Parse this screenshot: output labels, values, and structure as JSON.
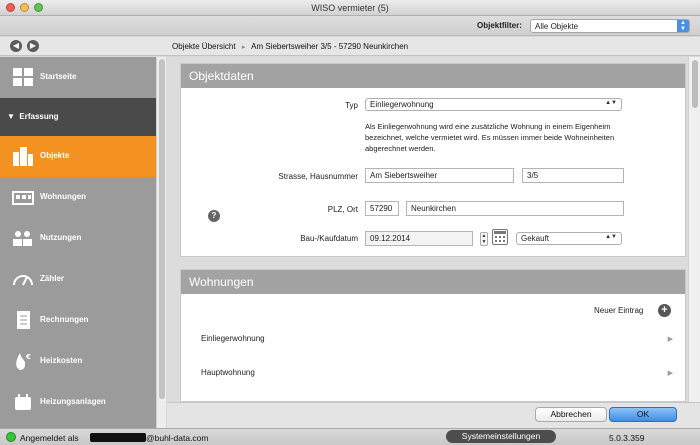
{
  "window": {
    "title": "WISO vermieter (5)"
  },
  "filter": {
    "label": "Objektfilter:",
    "value": "Alle Objekte"
  },
  "breadcrumb": [
    "Objekte Übersicht",
    "Am Siebertsweiher 3/5 - 57290 Neunkirchen"
  ],
  "sidebar": {
    "start": "Startseite",
    "section": "Erfassung",
    "items": [
      {
        "label": "Objekte",
        "icon": "buildings-icon",
        "active": true
      },
      {
        "label": "Wohnungen",
        "icon": "apartment-icon"
      },
      {
        "label": "Nutzungen",
        "icon": "people-icon"
      },
      {
        "label": "Zähler",
        "icon": "meter-icon"
      },
      {
        "label": "Rechnungen",
        "icon": "invoice-icon"
      },
      {
        "label": "Heizkosten",
        "icon": "flame-euro-icon"
      },
      {
        "label": "Heizungsanlagen",
        "icon": "heater-icon"
      }
    ],
    "accent": "#f39220"
  },
  "objektdaten": {
    "title": "Objektdaten",
    "typ_label": "Typ",
    "typ_value": "Einliegerwohnung",
    "description": "Als Einliegerwohnung wird eine zusätzliche Wohnung in einem Eigenheim bezeichnet, welche vermietet wird. Es müssen immer beide Wohneinheiten abgerechnet werden.",
    "strasse_label": "Strasse, Hausnummer",
    "strasse_value": "Am Siebertsweiher",
    "hausnummer_value": "3/5",
    "plz_label": "PLZ, Ort",
    "plz_value": "57290",
    "ort_value": "Neunkirchen",
    "datum_label": "Bau-/Kaufdatum",
    "datum_value": "09.12.2014",
    "art_value": "Gekauft"
  },
  "wohnungen": {
    "title": "Wohnungen",
    "new_entry": "Neuer Eintrag",
    "rows": [
      "Einliegerwohnung",
      "Hauptwohnung"
    ]
  },
  "buttons": {
    "cancel": "Abbrechen",
    "ok": "OK"
  },
  "status": {
    "logged_in": "Angemeldet als",
    "domain": "@buhl-data.com",
    "settings": "Systemeinstellungen",
    "version": "5.0.3.359"
  }
}
